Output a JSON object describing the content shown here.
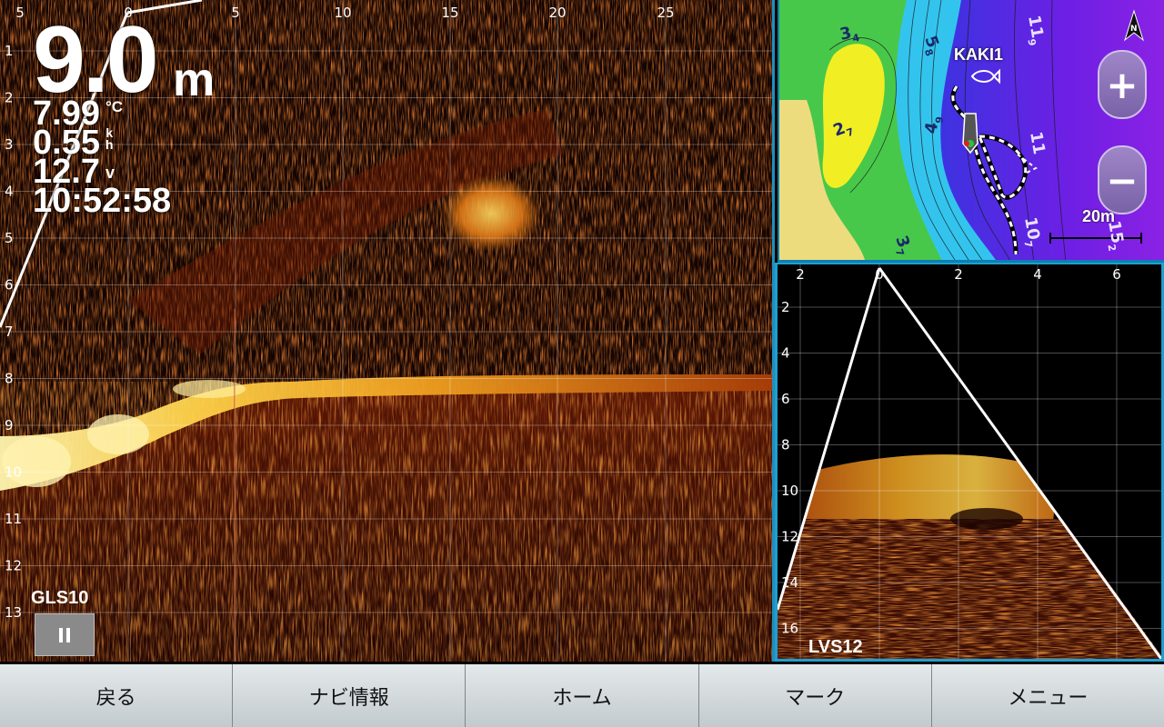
{
  "main_view": {
    "top_axis": [
      "5",
      "0",
      "5",
      "10",
      "15",
      "20",
      "25"
    ],
    "left_axis": [
      "1",
      "2",
      "3",
      "4",
      "5",
      "6",
      "7",
      "8",
      "9",
      "10",
      "11",
      "12",
      "13"
    ],
    "depth": {
      "value": "9.0",
      "unit": "m"
    },
    "water_temp": {
      "value": "7.99",
      "unit": "°C"
    },
    "speed": {
      "value": "0.55",
      "unit_top": "k",
      "unit_bottom": "h"
    },
    "voltage": {
      "value": "12.7",
      "unit": "v"
    },
    "time": "10:52:58",
    "source_label": "GLS10",
    "pause_icon": "pause-icon"
  },
  "chart_view": {
    "waypoint": "KAKI1",
    "contour_labels": [
      "3",
      "2",
      "5",
      "4",
      "11",
      "11",
      "10",
      "3",
      "15"
    ],
    "contour_subscripts": [
      "4",
      "7",
      "8",
      "9",
      "9",
      "",
      "7",
      "7",
      "2"
    ],
    "scale": "20m",
    "north_icon": "north-arrow-icon",
    "zoom_in": "+",
    "zoom_out": "−"
  },
  "down_view": {
    "top_axis": [
      "2",
      "0",
      "2",
      "4",
      "6"
    ],
    "left_axis": [
      "2",
      "4",
      "6",
      "8",
      "10",
      "12",
      "14",
      "16"
    ],
    "source_label": "LVS12"
  },
  "softkeys": [
    "戻る",
    "ナビ情報",
    "ホーム",
    "マーク",
    "メニュー"
  ],
  "colors": {
    "sonar_hot": "#ffe27a",
    "sonar_mid": "#d85a10",
    "sonar_dark": "#3a0b02",
    "panel_border": "#1f9fd0",
    "land": "#f0dd7a",
    "shallow": "#f4ee2a",
    "mid_green": "#4ec84a",
    "deep_cyan": "#30c4ec",
    "deep_blue": "#2a3ee0",
    "deep_purple": "#8a1fe0"
  }
}
